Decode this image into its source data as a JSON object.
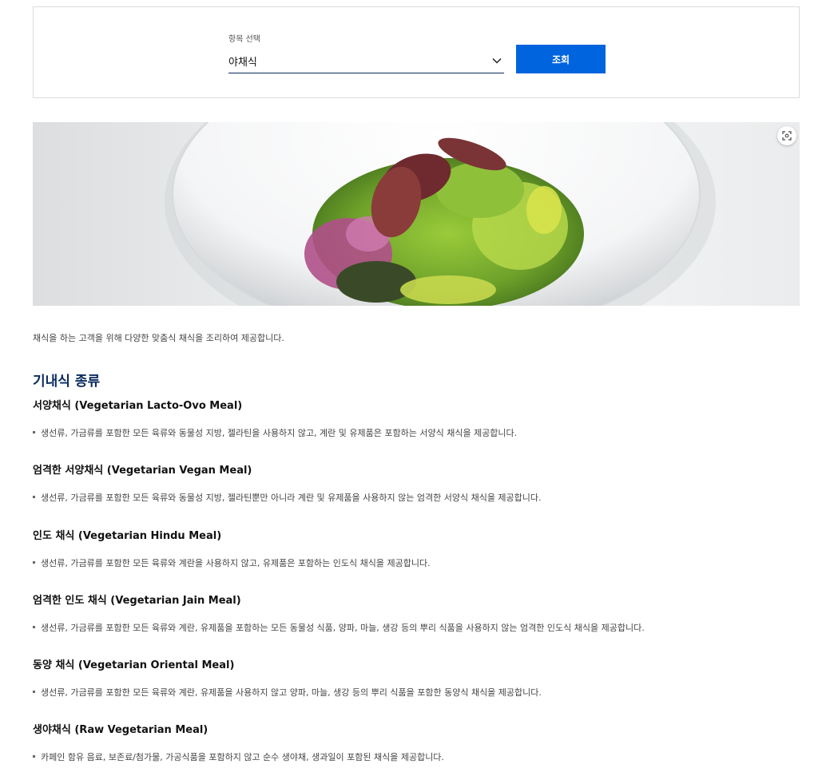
{
  "filter": {
    "label": "항목 선택",
    "selected": "야채식",
    "search_button": "조회"
  },
  "hero": {
    "alt": "야채식"
  },
  "intro": "채식을 하는 고객을 위해 다양한 맞춤식 채식을 조리하여 제공합니다.",
  "section_title": "기내식 종류",
  "meals": [
    {
      "title": "서양채식 (Vegetarian Lacto-Ovo Meal)",
      "desc": "생선류, 가금류를 포함한 모든 육류와 동물성 지방, 젤라틴을 사용하지 않고, 계란 및 유제품은 포함하는 서양식 채식을 제공합니다."
    },
    {
      "title": "엄격한 서양채식 (Vegetarian Vegan Meal)",
      "desc": "생선류, 가금류를 포함한 모든 육류와 동물성 지방, 젤라틴뿐만 아니라 계란 및 유제품을 사용하지 않는 엄격한 서양식 채식을 제공합니다."
    },
    {
      "title": "인도 채식 (Vegetarian Hindu Meal)",
      "desc": "생선류, 가금류를 포함한 모든 육류와 계란을 사용하지 않고, 유제품은 포함하는 인도식 채식을 제공합니다."
    },
    {
      "title": "엄격한 인도 채식 (Vegetarian Jain Meal)",
      "desc": "생선류, 가금류를 포함한 모든 육류와 계란, 유제품을 포함하는 모든 동물성 식품, 양파, 마늘, 생강 등의 뿌리 식품을 사용하지 않는 엄격한 인도식 채식을 제공합니다."
    },
    {
      "title": "동양 채식 (Vegetarian Oriental Meal)",
      "desc": "생선류, 가금류를 포함한 모든 육류와 계란, 유제품을 사용하지 않고 양파, 마늘, 생강 등의 뿌리 식품을 포함한 동양식 채식을 제공합니다."
    },
    {
      "title": "생야채식 (Raw Vegetarian Meal)",
      "desc": "카페인 함유 음료, 보존료/첨가물, 가공식품을 포함하지 않고 순수 생야채, 생과일이 포함된 채식을 제공합니다."
    }
  ],
  "colors": {
    "accent": "#0064de",
    "title": "#0a2a5e"
  },
  "icons": {
    "dropdown": "chevron-down-icon",
    "zoom": "zoom-icon"
  }
}
